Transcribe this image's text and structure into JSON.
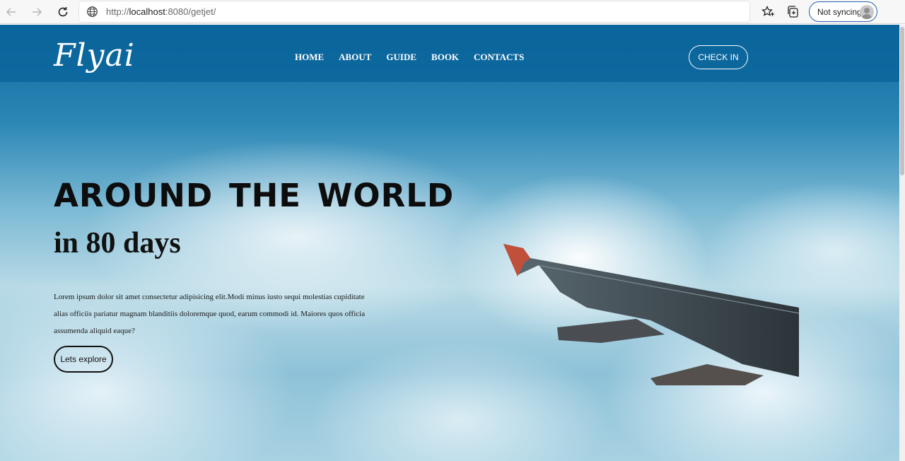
{
  "browser": {
    "url_scheme": "http://",
    "url_host": "localhost",
    "url_rest": ":8080/getjet/",
    "profile_label": "Not syncing"
  },
  "site": {
    "logo": "Flyai",
    "nav": [
      "HOME",
      "ABOUT",
      "GUIDE",
      "BOOK",
      "CONTACTS"
    ],
    "checkin_label": "CHECK IN"
  },
  "hero": {
    "title": "AROUND THE WORLD",
    "subtitle": "in 80 days",
    "text_lines": [
      "Lorem ipsum dolor sit amet consectetur adipisicing elit.Modi minus iusto sequi molestias cupiditate",
      "alias officiis pariatur magnam blanditiis doloremque quod, earum commodi id. Maiores quos officia",
      "assumenda aliquid eaque?"
    ],
    "button_label": "Lets explore"
  },
  "colors": {
    "nav_bar": "#0a649b",
    "sky_top": "#0d6b9e",
    "text_dark": "#0d0d0d",
    "profile_border": "#2a62a8"
  },
  "icons": {
    "back": "arrow-left-icon",
    "forward": "arrow-right-icon",
    "reload": "reload-icon",
    "site_info": "globe-icon",
    "favorites": "star-icon",
    "collections": "collections-icon",
    "avatar": "person-icon"
  }
}
